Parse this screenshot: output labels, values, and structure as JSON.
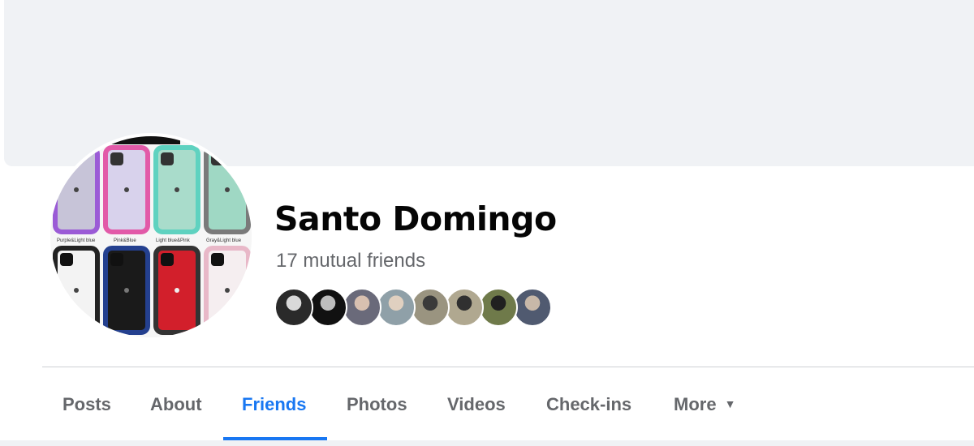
{
  "profile": {
    "name": "Santo Domingo",
    "mutual_friends": "17 mutual friends",
    "avatar_labels": [
      "Purple&Light blue",
      "Pink&Blue",
      "Light blue&Pink",
      "Gray&Light blue"
    ]
  },
  "mutual_friend_avatars": [
    {
      "name": "friend-avatar-1",
      "colors": [
        "#2a2a2a",
        "#d9d9d9"
      ]
    },
    {
      "name": "friend-avatar-2",
      "colors": [
        "#111111",
        "#bdbdbd"
      ]
    },
    {
      "name": "friend-avatar-3",
      "colors": [
        "#6a6a7a",
        "#d8c0b0"
      ]
    },
    {
      "name": "friend-avatar-4",
      "colors": [
        "#8fa0a8",
        "#e0d0c0"
      ]
    },
    {
      "name": "friend-avatar-5",
      "colors": [
        "#9a9480",
        "#3a3a3a"
      ]
    },
    {
      "name": "friend-avatar-6",
      "colors": [
        "#b0a890",
        "#303030"
      ]
    },
    {
      "name": "friend-avatar-7",
      "colors": [
        "#6f7a4a",
        "#202020"
      ]
    },
    {
      "name": "friend-avatar-8",
      "colors": [
        "#505a70",
        "#c8b8a8"
      ]
    }
  ],
  "tabs": [
    {
      "label": "Posts",
      "active": false
    },
    {
      "label": "About",
      "active": false
    },
    {
      "label": "Friends",
      "active": true
    },
    {
      "label": "Photos",
      "active": false
    },
    {
      "label": "Videos",
      "active": false
    },
    {
      "label": "Check-ins",
      "active": false
    },
    {
      "label": "More",
      "active": false
    }
  ],
  "colors": {
    "accent": "#1877f2",
    "cover": "#f0f2f5",
    "secondary_text": "#65676b"
  }
}
